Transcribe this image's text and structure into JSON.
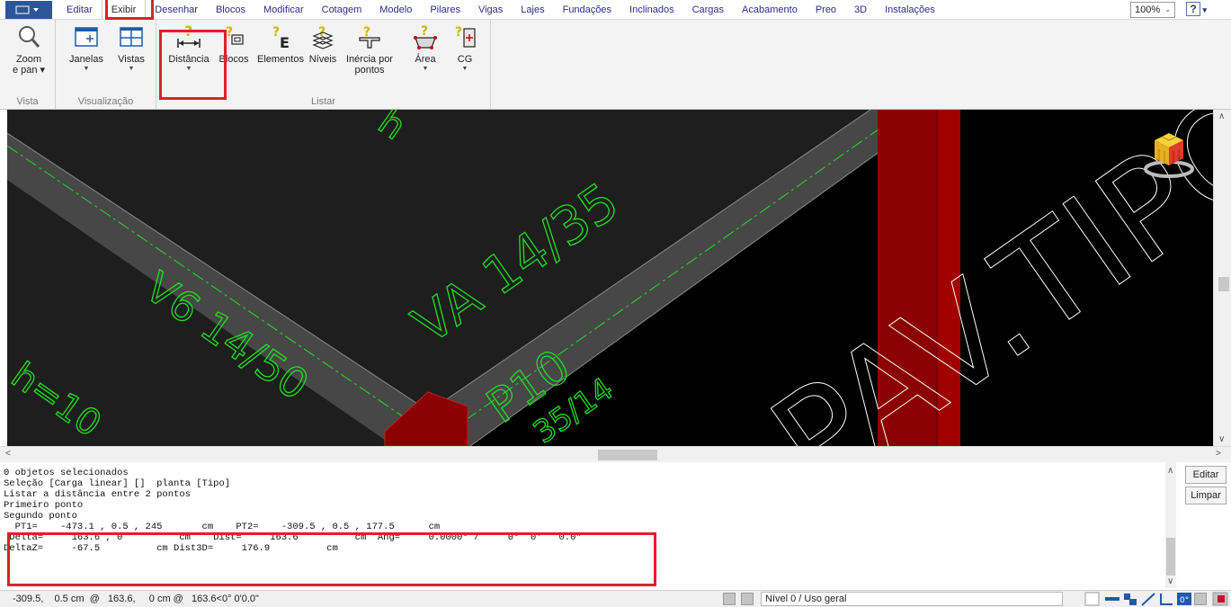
{
  "menubar": {
    "tabs": [
      "Editar",
      "Exibir",
      "Desenhar",
      "Blocos",
      "Modificar",
      "Cotagem",
      "Modelo",
      "Pilares",
      "Vigas",
      "Lajes",
      "Fundações",
      "Inclinados",
      "Cargas",
      "Acabamento",
      "Preo",
      "3D",
      "Instalações"
    ],
    "active_tab": "Exibir",
    "zoom": "100%"
  },
  "ribbon": {
    "groups": {
      "vista": "Vista",
      "visualizacao": "Visualização",
      "listar": "Listar"
    },
    "buttons": {
      "zoom_line1": "Zoom",
      "zoom_line2": "e pan ▾",
      "janelas": "Janelas",
      "vistas": "Vistas",
      "distancia": "Distância",
      "blocos": "Blocos",
      "elementos": "Elementos",
      "niveis": "Níveis",
      "inercia_line1": "Inércia por",
      "inercia_line2": "pontos",
      "area": "Área",
      "cg": "CG"
    }
  },
  "viewport": {
    "labels": {
      "beam_va": "VA  14/35",
      "beam_v6": "V6  14/50",
      "pillar": "P10",
      "pillar_dim": "35/14",
      "slab_h": "h=10",
      "slab_h_top": "h",
      "floor_text": "PAV.TIPO"
    },
    "colors": {
      "background": "#1e1e1e",
      "beam": "#4a4a4a",
      "pillar": "#8b0000",
      "annotation": "#1fe01f",
      "text": "#ffffff"
    }
  },
  "console": {
    "lines": [
      "0 objetos selecionados",
      "Seleção [Carga linear] []  planta [Tipo]",
      "Listar a distância entre 2 pontos",
      "Primeiro ponto",
      "Segundo ponto",
      "  PT1=    -473.1 , 0.5 , 245       cm    PT2=    -309.5 , 0.5 , 177.5      cm",
      " Delta=     163.6 , 0          cm    Dist=     163.6          cm  Ang=     0.0000° /     0°  0'   0.0\"",
      "DeltaZ=     -67.5          cm Dist3D=     176.9          cm"
    ],
    "buttons": {
      "editar": "Editar",
      "limpar": "Limpar"
    }
  },
  "statusbar": {
    "coords": "-309.5,    0.5 cm  @   163.6,     0 cm @   163.6<0° 0'0.0\"",
    "level": "Nível 0 / Uso geral"
  }
}
